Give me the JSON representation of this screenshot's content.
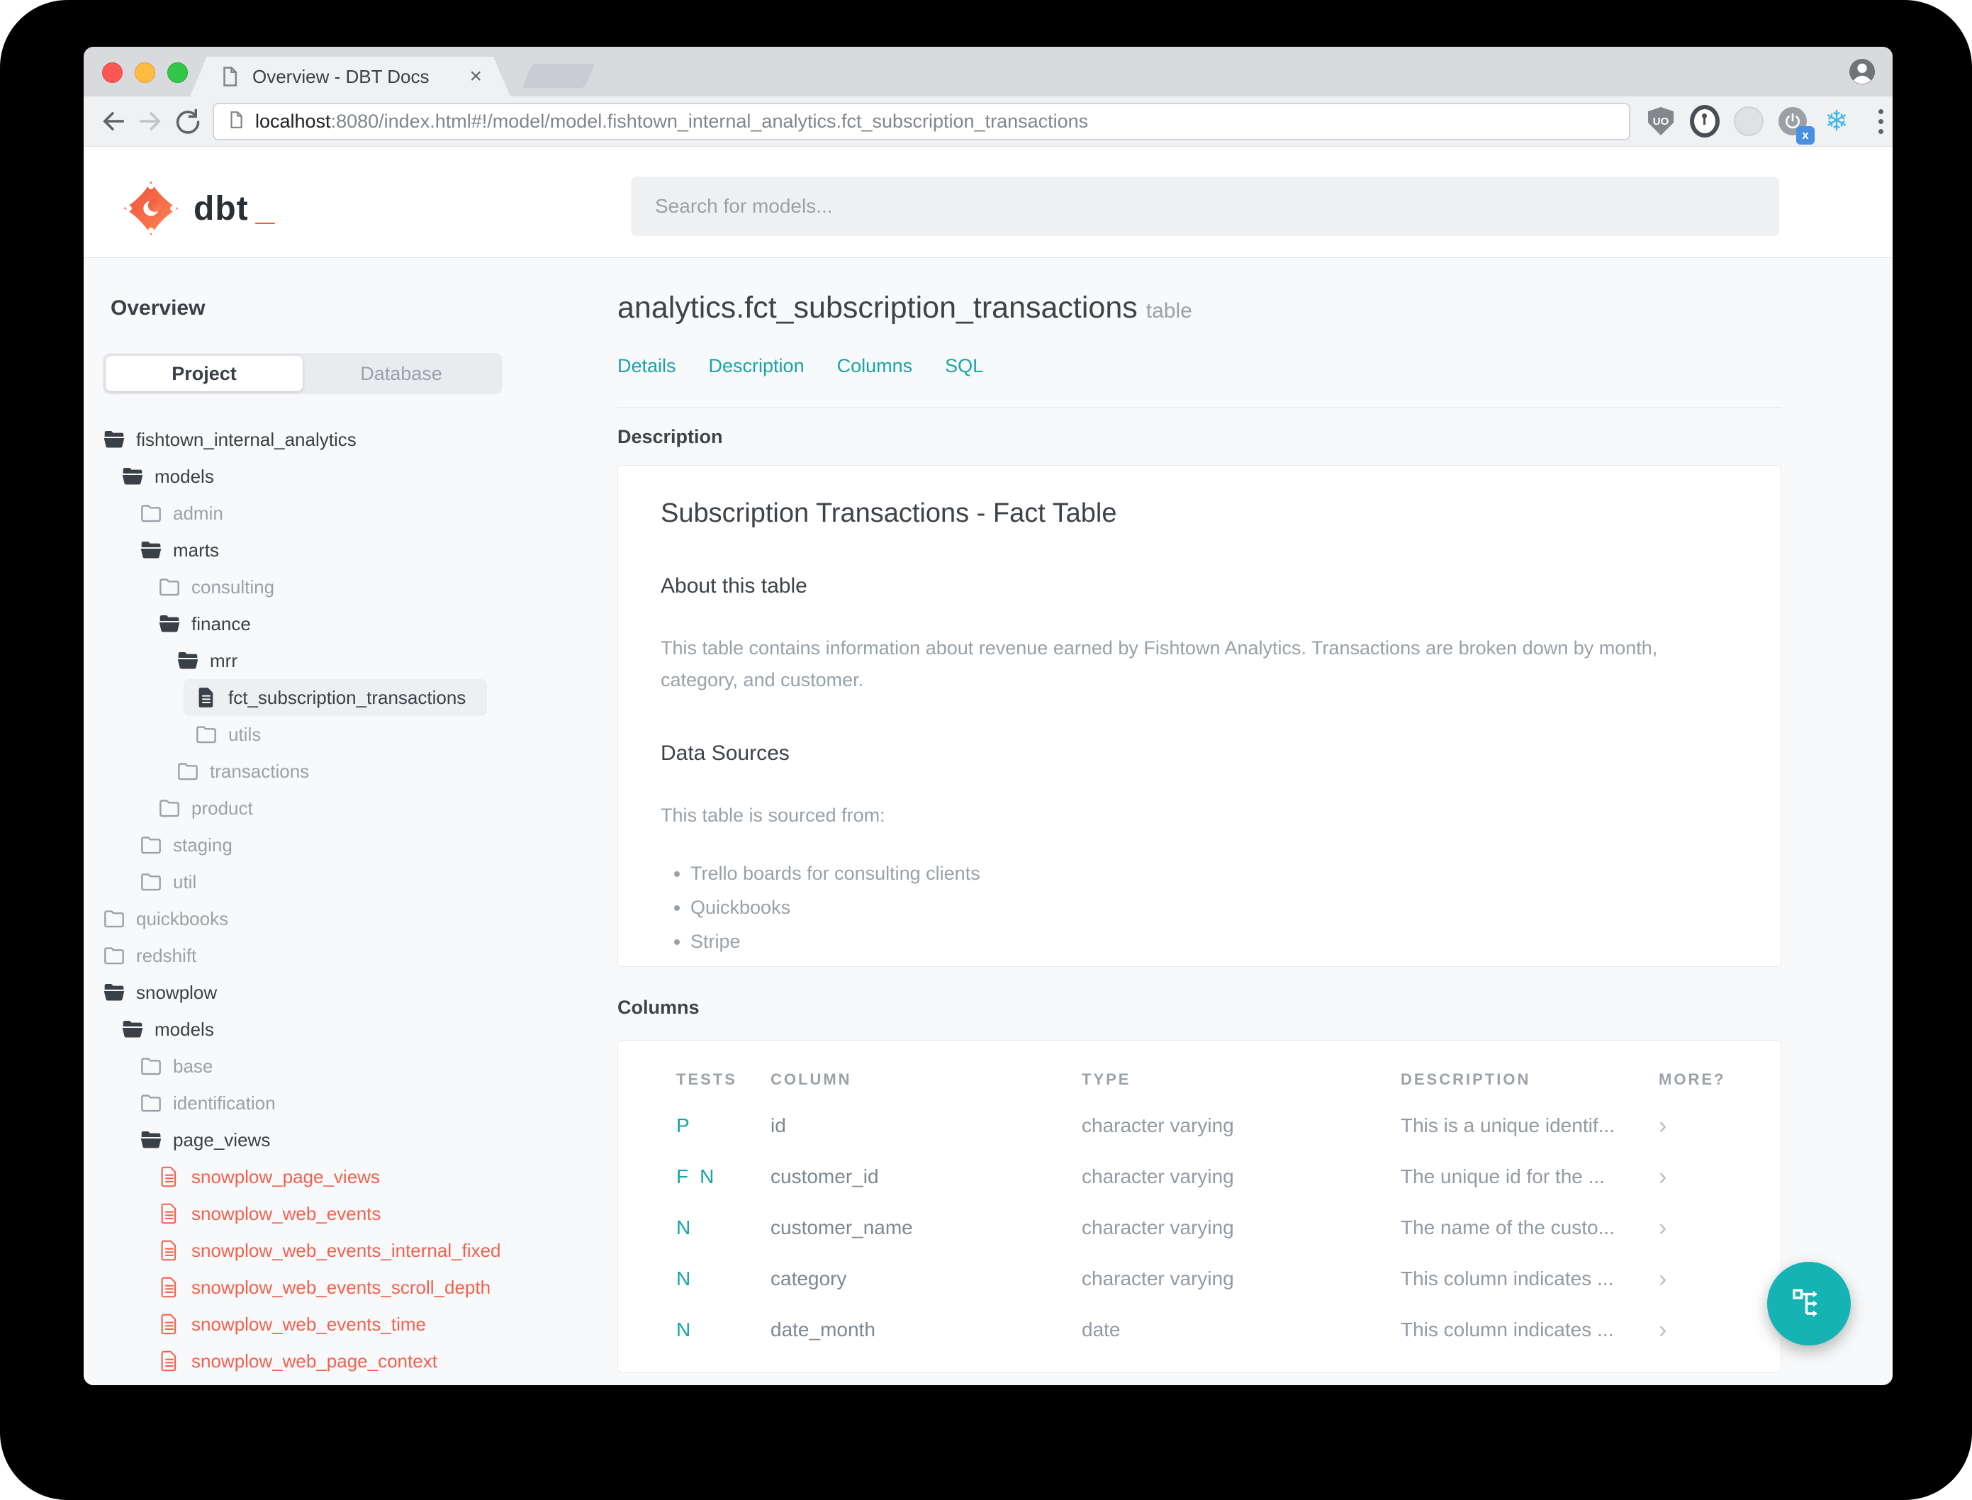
{
  "colors": {
    "accent": "#17a5a5",
    "accent_red": "#f2614d",
    "fab": "#15b3b3",
    "logo_orange": "#fa5338"
  },
  "browser": {
    "tab_title": "Overview - DBT Docs",
    "tab_close_glyph": "×",
    "url_host": "localhost",
    "url_rest": ":8080/index.html#!/model/model.fishtown_internal_analytics.fct_subscription_transactions",
    "ublock_label": "UO",
    "power_badge": "x"
  },
  "header": {
    "logo_text": "dbt",
    "logo_underscore": "_",
    "search_placeholder": "Search for models..."
  },
  "sidebar": {
    "overview_label": "Overview",
    "tabs": [
      {
        "label": "Project",
        "active": true
      },
      {
        "label": "Database",
        "active": false
      }
    ],
    "tree": [
      {
        "label": "fishtown_internal_analytics",
        "depth": 0,
        "icon": "folder-open",
        "tone": "dark"
      },
      {
        "label": "models",
        "depth": 1,
        "icon": "folder-open",
        "tone": "dark"
      },
      {
        "label": "admin",
        "depth": 2,
        "icon": "folder",
        "tone": "muted"
      },
      {
        "label": "marts",
        "depth": 2,
        "icon": "folder-open",
        "tone": "dark"
      },
      {
        "label": "consulting",
        "depth": 3,
        "icon": "folder",
        "tone": "muted"
      },
      {
        "label": "finance",
        "depth": 3,
        "icon": "folder-open",
        "tone": "dark"
      },
      {
        "label": "mrr",
        "depth": 4,
        "icon": "folder-open",
        "tone": "dark"
      },
      {
        "label": "fct_subscription_transactions",
        "depth": 5,
        "icon": "file-solid",
        "tone": "dark",
        "selected": true
      },
      {
        "label": "utils",
        "depth": 5,
        "icon": "folder",
        "tone": "muted"
      },
      {
        "label": "transactions",
        "depth": 4,
        "icon": "folder",
        "tone": "muted"
      },
      {
        "label": "product",
        "depth": 3,
        "icon": "folder",
        "tone": "muted"
      },
      {
        "label": "staging",
        "depth": 2,
        "icon": "folder",
        "tone": "muted"
      },
      {
        "label": "util",
        "depth": 2,
        "icon": "folder",
        "tone": "muted"
      },
      {
        "label": "quickbooks",
        "depth": 0,
        "icon": "folder",
        "tone": "muted"
      },
      {
        "label": "redshift",
        "depth": 0,
        "icon": "folder",
        "tone": "muted"
      },
      {
        "label": "snowplow",
        "depth": 0,
        "icon": "folder-open",
        "tone": "dark"
      },
      {
        "label": "models",
        "depth": 1,
        "icon": "folder-open",
        "tone": "dark"
      },
      {
        "label": "base",
        "depth": 2,
        "icon": "folder",
        "tone": "muted"
      },
      {
        "label": "identification",
        "depth": 2,
        "icon": "folder",
        "tone": "muted"
      },
      {
        "label": "page_views",
        "depth": 2,
        "icon": "folder-open",
        "tone": "dark"
      },
      {
        "label": "snowplow_page_views",
        "depth": 3,
        "icon": "file-outline",
        "tone": "accent"
      },
      {
        "label": "snowplow_web_events",
        "depth": 3,
        "icon": "file-outline",
        "tone": "accent"
      },
      {
        "label": "snowplow_web_events_internal_fixed",
        "depth": 3,
        "icon": "file-outline",
        "tone": "accent"
      },
      {
        "label": "snowplow_web_events_scroll_depth",
        "depth": 3,
        "icon": "file-outline",
        "tone": "accent"
      },
      {
        "label": "snowplow_web_events_time",
        "depth": 3,
        "icon": "file-outline",
        "tone": "accent"
      },
      {
        "label": "snowplow_web_page_context",
        "depth": 3,
        "icon": "file-outline",
        "tone": "accent"
      }
    ]
  },
  "main": {
    "title": "analytics.fct_subscription_transactions",
    "title_badge": "table",
    "nav_links": [
      "Details",
      "Description",
      "Columns",
      "SQL"
    ],
    "description_section_label": "Description",
    "doc": {
      "heading": "Subscription Transactions - Fact Table",
      "about_heading": "About this table",
      "about_text": "This table contains information about revenue earned by Fishtown Analytics. Transactions are broken down by month, category, and customer.",
      "sources_heading": "Data Sources",
      "sources_intro": "This table is sourced from:",
      "sources": [
        "Trello boards for consulting clients",
        "Quickbooks",
        "Stripe"
      ]
    },
    "columns_section_label": "Columns",
    "columns_table": {
      "headers": [
        "TESTS",
        "COLUMN",
        "TYPE",
        "DESCRIPTION",
        "MORE?"
      ],
      "more_icon": "›",
      "rows": [
        {
          "tests": [
            "P"
          ],
          "column": "id",
          "type": "character varying",
          "description": "This is a unique identif..."
        },
        {
          "tests": [
            "F",
            "N"
          ],
          "column": "customer_id",
          "type": "character varying",
          "description": "The unique id for the ..."
        },
        {
          "tests": [
            "N"
          ],
          "column": "customer_name",
          "type": "character varying",
          "description": "The name of the custo..."
        },
        {
          "tests": [
            "N"
          ],
          "column": "category",
          "type": "character varying",
          "description": "This column indicates ..."
        },
        {
          "tests": [
            "N"
          ],
          "column": "date_month",
          "type": "date",
          "description": "This column indicates ..."
        }
      ]
    }
  }
}
